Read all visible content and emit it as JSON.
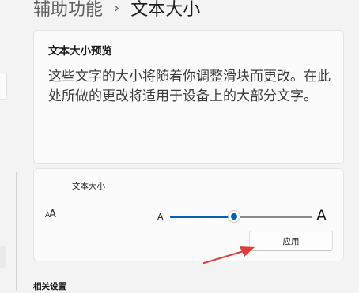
{
  "breadcrumb": {
    "parent": "辅助功能",
    "separator": "›",
    "current": "文本大小"
  },
  "preview": {
    "title": "文本大小预览",
    "text": "这些文字的大小将随着你调整滑块而更改。在此处所做的更改将适用于设备上的大部分文字。"
  },
  "text_size": {
    "label": "文本大小",
    "icon": "text-size-icon",
    "min_label": "A",
    "max_label": "A",
    "slider_level": 0.45,
    "apply_label": "应用"
  },
  "related": {
    "title": "相关设置"
  },
  "colors": {
    "accent": "#005fb8",
    "annotation_arrow": "#e23b3b"
  }
}
